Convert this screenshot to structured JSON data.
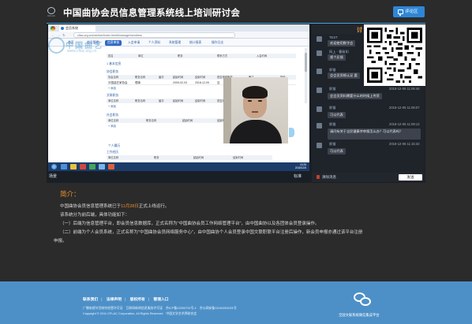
{
  "header": {
    "logo_text": "CFLAC",
    "title": "中国曲协会员信息管理系统线上培训研讨会",
    "evaluate_label": "评论区"
  },
  "player": {
    "scene_label": "场景",
    "quality_label": "标准",
    "browser": {
      "tab_label": "会员系统",
      "url": "cflac.org.cn/member/index.html#/manage/members",
      "nav_items": [
        "首页",
        "会员管理",
        "信息审核",
        "入会申请",
        "个人资料",
        "系统管理",
        "统计报表",
        "操作日志"
      ],
      "watermark_text": "中国曲艺",
      "watermark_sub": "www.cflac.org.cn",
      "header_fields": [
        "姓名",
        "单位",
        "职务",
        "联系方式",
        "入会时间"
      ],
      "sections": [
        {
          "title": "1 基本信息"
        },
        {
          "title": "协会职务",
          "columns": [
            "协会名称",
            "职务名称",
            "届次",
            "起始时间",
            "结束时间",
            "是否现任职务",
            "备注",
            "操作"
          ],
          "row": [
            "中国曲艺家协会",
            "理事",
            "",
            "2009-02-03",
            "2018-12-09",
            "否",
            "",
            ""
          ],
          "add": "添加"
        },
        {
          "title": "文联职务",
          "columns": [
            "单位名称",
            "职务名称",
            "届次",
            "起始时间",
            "结束时间",
            "是否现任职务",
            "备注"
          ],
          "add": "添加"
        },
        {
          "title": "社会职务",
          "columns": [
            "单位名称",
            "职务名称",
            "起始时间",
            "结束时间",
            "备注"
          ],
          "add": "添加"
        },
        {
          "title": "个人履历"
        },
        {
          "title": "工作经历",
          "columns": [
            "单位名称",
            "职务",
            "起始时间",
            "结束时间"
          ]
        }
      ],
      "clock_time": "10:25",
      "clock_date": "2018/12/6"
    }
  },
  "chat": {
    "header_label": "讨",
    "messages": [
      {
        "name": "TEST",
        "time": "",
        "text": "欢迎使用数字会"
      },
      {
        "name": "网上 - 曹雅如",
        "time": "",
        "text": "视个反馈"
      },
      {
        "name": "胖猫",
        "time": "",
        "text": "会会员资格认证 要"
      },
      {
        "name": "胖猫",
        "time": "2018-12-06 11:06:48",
        "text": "会会员资料需要什么的时候上传资"
      },
      {
        "name": "胖猫",
        "time": "2018-12-06 11:08:07",
        "text": "可以代表"
      },
      {
        "name": "胖猫",
        "time": "2018-12-06 11:09:12",
        "text": "请问有关于全民健康并审报怎么办？可以代表吗？"
      },
      {
        "name": "胖猫",
        "time": "2018-12-06 11:15:32",
        "text": "可以代表"
      }
    ],
    "clear_label": "清除消息",
    "send_label": "发送"
  },
  "intro": {
    "title": "简介：",
    "p1_before": "中国曲协会员信息管理系统已于",
    "p1_highlight": "11月28日",
    "p1_after": "正式上线运行。",
    "p2": "该系统分为前后端，具体功能如下：",
    "p3": "（一）后端为信息管理平台，即会员信息数据库，正式名称为\"中国曲协会员工作网络管理平台\"，由中国曲协以及各团体会员登录操作。",
    "p4": "（二）前端为个人会员系统，正式名称为\"中国曲协会员网络服务中心\"，由中国曲协个人会员登录中国文联职联平台注册后操作，新会员申报亦通过该平台注册",
    "p5": "申报。"
  },
  "footer": {
    "links": [
      "联系我们",
      "法律声明",
      "版权所有",
      "管理入口"
    ],
    "line1": "广播电视节目制作经营许可证　互联网新闻信息服务许可证　京ICP备12000731号-1　京公网安备11040204001号",
    "line2": "Copyright © 2011 CFLAC Corporation, All Rights Reserved　中国文学艺术界联合会",
    "wechat_label": "全国文联系统微信集成平台"
  }
}
